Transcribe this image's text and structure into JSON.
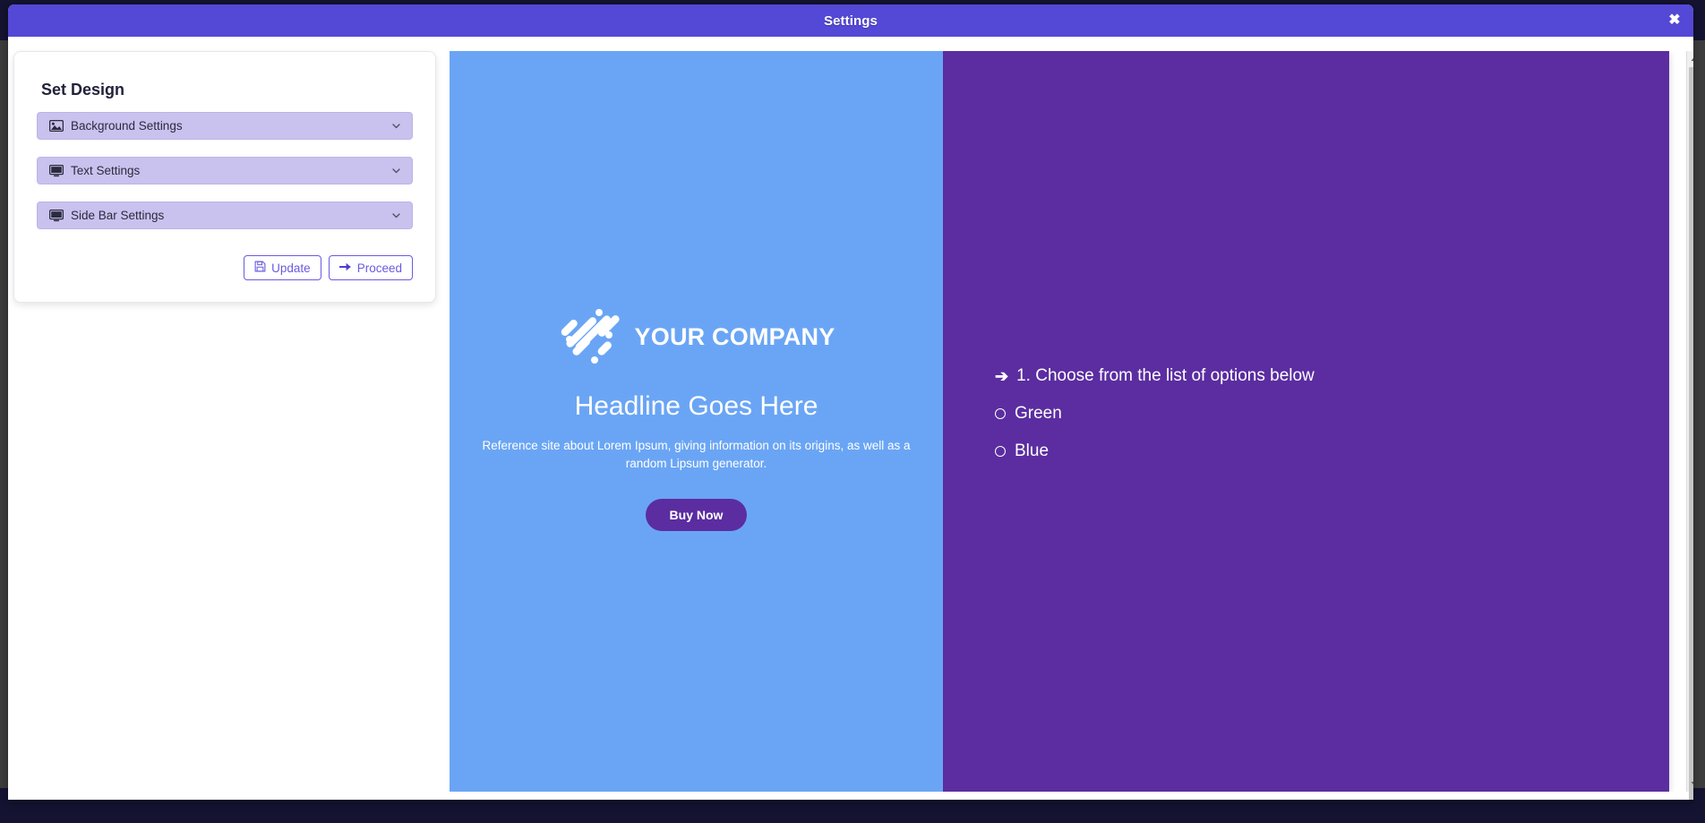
{
  "window": {
    "title": "Settings",
    "close_label": "✖"
  },
  "settings_card": {
    "heading": "Set Design",
    "accordions": [
      {
        "label": "Background Settings",
        "icon": "image-icon",
        "chevron": "chevron-down-icon"
      },
      {
        "label": "Text Settings",
        "icon": "desktop-icon",
        "chevron": "chevron-down-icon"
      },
      {
        "label": "Side Bar Settings",
        "icon": "desktop-icon",
        "chevron": "chevron-down-icon"
      }
    ],
    "buttons": {
      "update": "Update",
      "proceed": "Proceed"
    }
  },
  "preview": {
    "blue_panel": {
      "background_color": "#6aa5f5",
      "logo_text": "YOUR COMPANY",
      "headline": "Headline Goes Here",
      "subcopy": "Reference site about Lorem Ipsum, giving information on its origins, as well as a random Lipsum generator.",
      "cta_label": "Buy Now",
      "cta_color": "#5b2da0"
    },
    "purple_panel": {
      "background_color": "#5b2da0",
      "question": "1. Choose from the list of options below",
      "question_arrow": "➔",
      "options": [
        {
          "label": "Green",
          "selected": false
        },
        {
          "label": "Blue",
          "selected": false
        }
      ]
    }
  },
  "scrollbar": {
    "up_arrow": "▲",
    "down_arrow": "▼"
  },
  "colors": {
    "titlebar": "#5448d6",
    "accent": "#6a5ae0",
    "accordion": "#c9c2ee",
    "desktop": "#141331"
  }
}
